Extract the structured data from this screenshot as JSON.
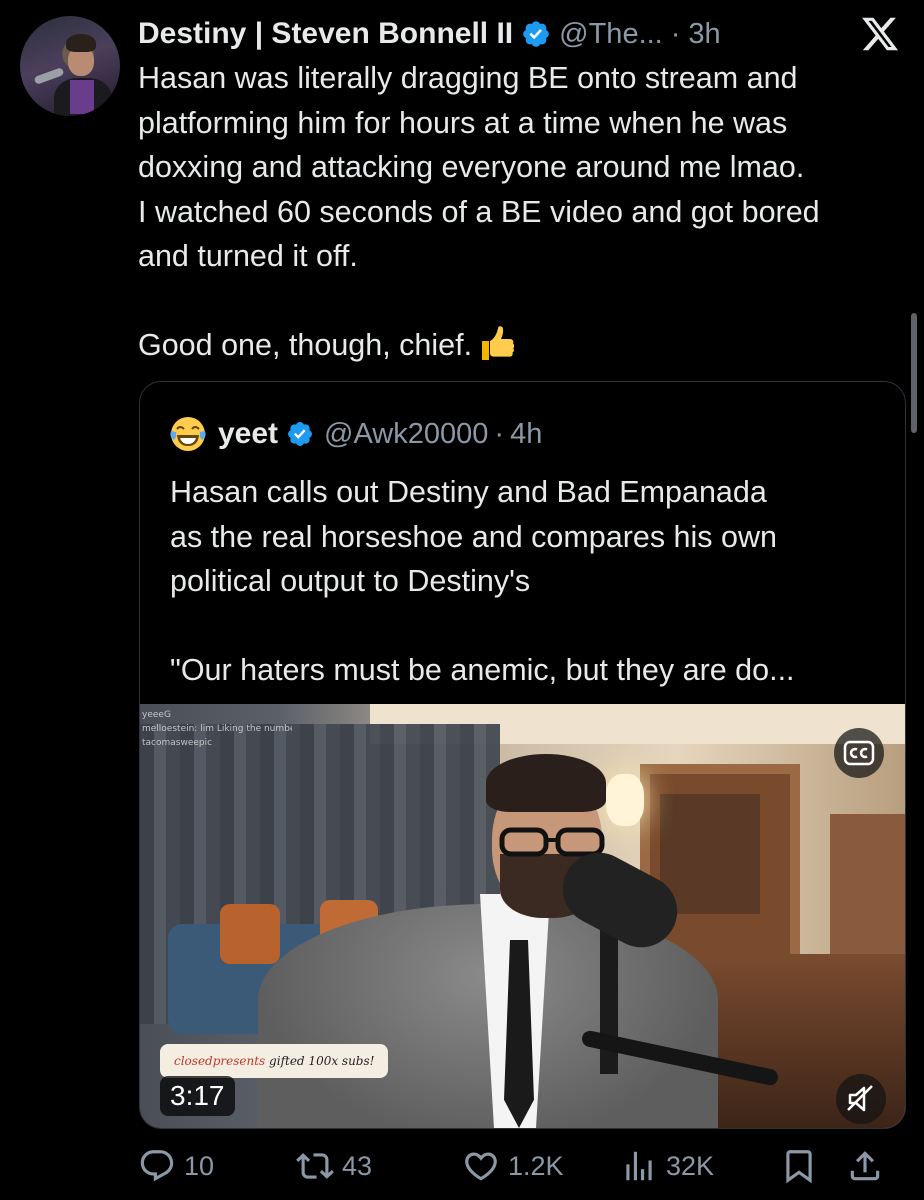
{
  "tweet": {
    "author_name": "Destiny | Steven Bonnell II",
    "author_handle": "@The...",
    "separator": "·",
    "time": "3h",
    "text_lines": [
      "Hasan was literally dragging BE onto stream and",
      "platforming him for hours at a time when he was",
      "doxxing and attacking everyone around me lmao.",
      "I watched 60 seconds of a BE video and got bored",
      "and turned it off."
    ],
    "text_closing": "Good one, though, chief."
  },
  "quote": {
    "author_name": "yeet",
    "author_handle": "@Awk20000",
    "separator": "·",
    "time": "4h",
    "text_lines": [
      "Hasan calls out Destiny and Bad Empanada",
      "as the real horseshoe and compares his own",
      "political output to Destiny's"
    ],
    "text_quote": "\"Our haters must be anemic, but they are do...",
    "video": {
      "duration": "3:17",
      "chat_lines": [
        "yeeeG",
        "melloestein: lim Liking the numbers",
        "tacomasweepic"
      ],
      "sub_alert_user": "closedpresents",
      "sub_alert_text": "gifted 100x subs!"
    }
  },
  "actions": {
    "replies": "10",
    "reposts": "43",
    "likes": "1.2K",
    "views": "32K"
  },
  "icons": {
    "platform": "x-logo-icon",
    "verified": "verified-badge-icon",
    "emoji_thumb": "thumbs-up-emoji",
    "emoji_laugh": "laughing-crying-emoji",
    "captions": "cc-icon",
    "mute": "muted-speaker-icon",
    "reply": "reply-icon",
    "repost": "repost-icon",
    "like": "heart-icon",
    "views": "views-icon",
    "bookmark": "bookmark-icon",
    "share": "share-icon"
  },
  "colors": {
    "background": "#000000",
    "text_primary": "#e7e9ea",
    "text_secondary": "#8b98a5",
    "verified_blue": "#1d9bf0",
    "border": "#2f3336"
  }
}
